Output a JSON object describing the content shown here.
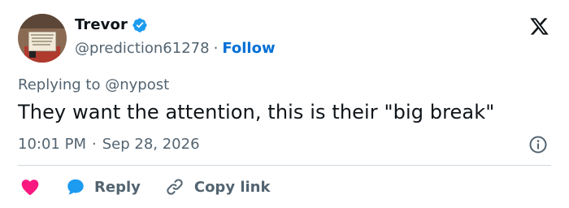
{
  "user": {
    "name": "Trevor",
    "handle": "@prediction61278",
    "separator": "·",
    "follow_label": "Follow"
  },
  "reply_context": {
    "prefix": "Replying to",
    "mention": "@nypost"
  },
  "tweet": {
    "text": "They want the attention, this is their \"big break\"",
    "time": "10:01 PM",
    "separator": "·",
    "date": "Sep 28, 2026"
  },
  "actions": {
    "reply_label": "Reply",
    "copy_link_label": "Copy link"
  },
  "colors": {
    "accent": "#1d9bf0",
    "heart": "#f91880",
    "follow": "#006fd6",
    "muted": "#536471",
    "text": "#0f1419"
  },
  "icons": {
    "verified": "verified-badge-icon",
    "logo": "x-logo-icon",
    "info": "info-icon",
    "like": "heart-icon",
    "reply": "reply-bubble-icon",
    "copy": "link-icon"
  }
}
